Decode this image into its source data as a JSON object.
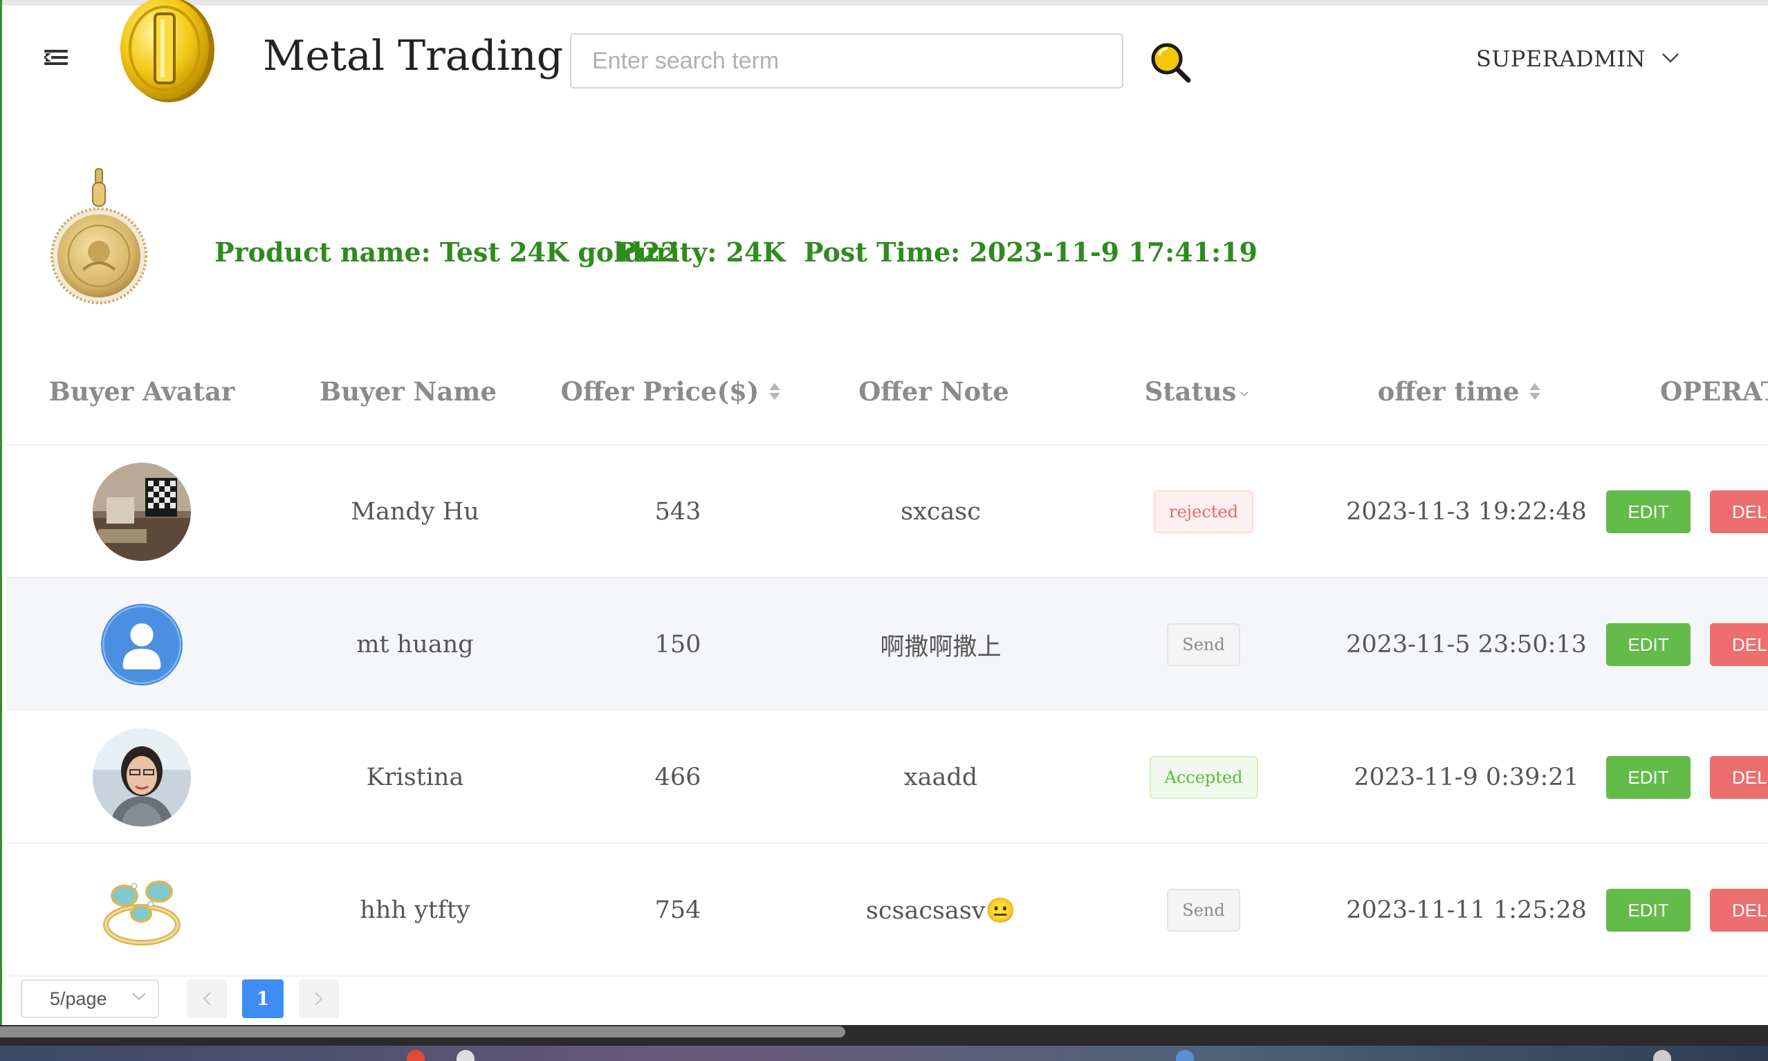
{
  "header": {
    "app_title": "Metal Trading",
    "search_placeholder": "Enter search term",
    "user_name": "SUPERADMIN"
  },
  "product": {
    "name_text": "Product name: Test 24K gold22",
    "purity_text": "Purity: 24K",
    "post_time_text": "Post Time: 2023-11-9 17:41:19"
  },
  "table": {
    "columns": [
      "Buyer Avatar",
      "Buyer Name",
      "Offer Price($)",
      "Offer Note",
      "Status",
      "offer time",
      "OPERAT"
    ],
    "rows": [
      {
        "buyer_name": "Mandy Hu",
        "offer_price": "543",
        "offer_note": "sxcasc",
        "status": "rejected",
        "offer_time": "2023-11-3 19:22:48",
        "avatar": "room-photo"
      },
      {
        "buyer_name": "mt huang",
        "offer_price": "150",
        "offer_note": "啊撒啊撒上",
        "status": "Send",
        "offer_time": "2023-11-5 23:50:13",
        "avatar": "default-user-icon"
      },
      {
        "buyer_name": "Kristina",
        "offer_price": "466",
        "offer_note": "xaadd",
        "status": "Accepted",
        "offer_time": "2023-11-9 0:39:21",
        "avatar": "person-photo"
      },
      {
        "buyer_name": "hhh ytfty",
        "offer_price": "754",
        "offer_note": "scsacsasv😐",
        "status": "Send",
        "offer_time": "2023-11-11 1:25:28",
        "avatar": "ring-photo"
      }
    ],
    "edit_label": "EDIT",
    "delete_label": "DELETE"
  },
  "pagination": {
    "page_size": "5/page",
    "current_page": "1"
  },
  "colors": {
    "accent_green": "#2e8b1e",
    "edit_button": "#63bb4a",
    "delete_button": "#ec6e6e",
    "page_active": "#3d8cf7"
  }
}
